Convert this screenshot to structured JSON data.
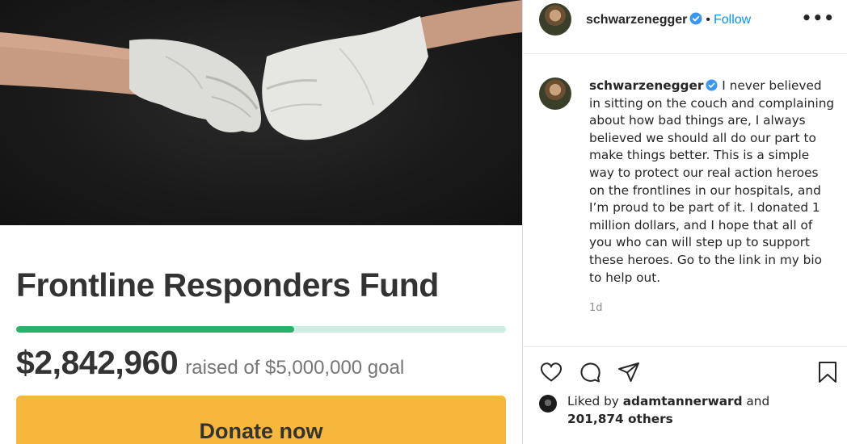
{
  "campaign": {
    "title": "Frontline Responders Fund",
    "progress": 0.568,
    "amount_raised": "$2,842,960",
    "goal_text": "raised of $5,000,000 goal",
    "donate_label": "Donate now"
  },
  "post": {
    "username": "schwarzenegger",
    "separator": "•",
    "follow_label": "Follow",
    "more_label": "•••",
    "caption_author": "schwarzenegger",
    "caption": " I never believed in sitting on the couch and complaining about how bad things are, I always believed we should all do our part to make things better. This is a simple way to protect our real action heroes on the frontlines in our hospitals, and I’m proud to be part of it. I donated 1 million dollars, and I hope that all of you who can will step up to support these heroes. Go to the link in my bio to help out.",
    "timestamp": "1d",
    "liked_prefix": "Liked by ",
    "liked_user": "adamtannerward",
    "liked_and": " and",
    "liked_others": "201,874 others"
  },
  "colors": {
    "progress_fill": "#26b26a",
    "progress_track": "#cdeee0",
    "donate_button": "#f6b73c",
    "follow_blue": "#0095f6",
    "verified_blue": "#3897f0"
  },
  "icons": [
    "verified-badge-icon",
    "heart-icon",
    "comment-icon",
    "share-icon",
    "bookmark-icon",
    "more-options-icon"
  ]
}
